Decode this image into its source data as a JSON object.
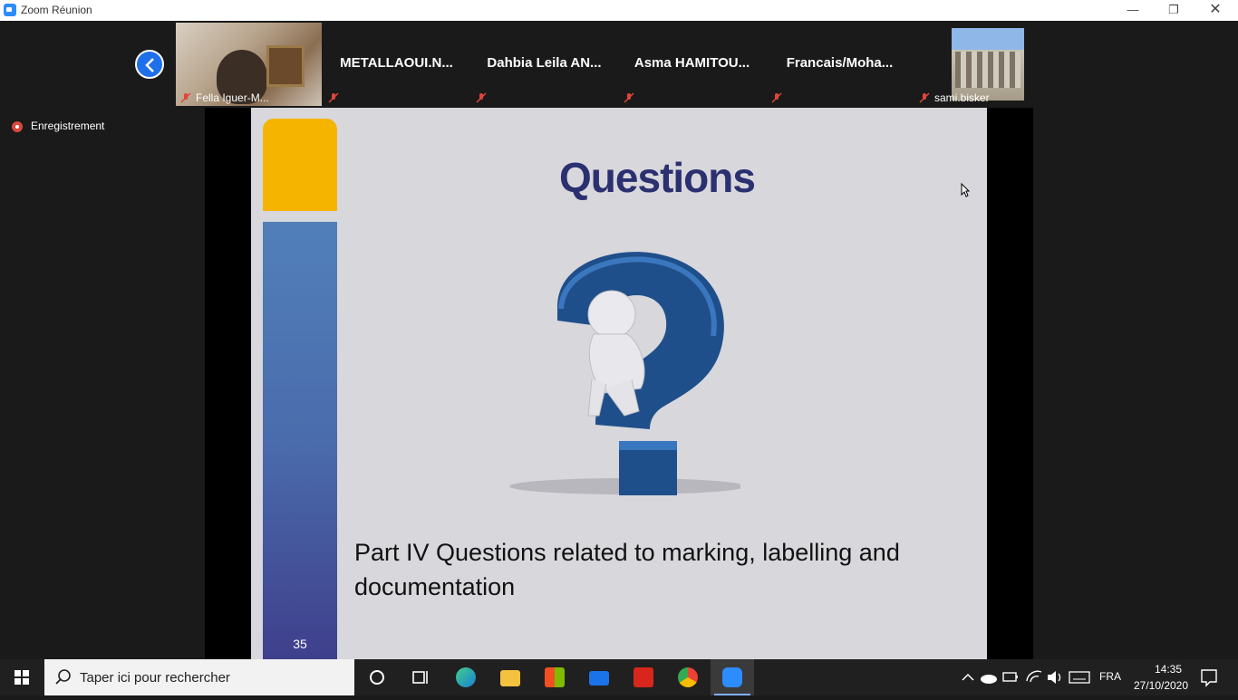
{
  "window": {
    "title": "Zoom Réunion"
  },
  "recording": {
    "label": "Enregistrement"
  },
  "participants": [
    {
      "name": "Fella Iguer-M..."
    },
    {
      "name": "METALLAOUI.N..."
    },
    {
      "name": "Dahbia Leila AN..."
    },
    {
      "name": "Asma HAMITOU..."
    },
    {
      "name": "Francais/Moha..."
    },
    {
      "name": "sami.bisker"
    }
  ],
  "slide": {
    "title": "Questions",
    "body": "Part IV Questions related to marking, labelling and documentation",
    "page_number": "35",
    "colors": {
      "title": "#2b3070",
      "accent_yellow": "#f5b400",
      "bar_blue": "#4a6cac"
    }
  },
  "taskbar": {
    "search_placeholder": "Taper ici pour rechercher",
    "language": "FRA",
    "time": "14:35",
    "date": "27/10/2020",
    "apps": [
      "cortana-icon",
      "task-view-icon",
      "edge-icon",
      "file-explorer-icon",
      "store-icon",
      "mail-icon",
      "acrobat-icon",
      "chrome-icon",
      "zoom-icon"
    ]
  }
}
